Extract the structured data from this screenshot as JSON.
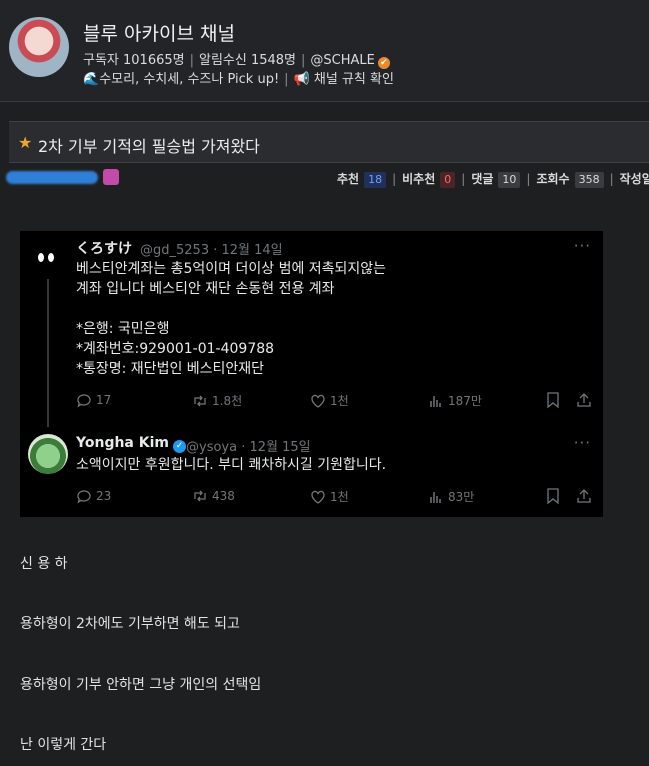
{
  "channel": {
    "name": "블루 아카이브 채널",
    "subscribers": "구독자 101665명",
    "notifications": "알림수신 1548명",
    "handle": "@SCHALE",
    "verified_mark": "✔",
    "link1_icon": "🌊",
    "link1": "수모리, 수치세, 수즈나 Pick up!",
    "link2_icon": "📢",
    "link2": "채널 규칙 확인"
  },
  "post": {
    "star": "★",
    "title": "2차 기부 기적의 필승법 가져왔다",
    "stats": {
      "recommend_label": "추천",
      "recommend": "18",
      "unrecommend_label": "비추천",
      "unrecommend": "0",
      "comments_label": "댓글",
      "comments": "10",
      "views_label": "조회수",
      "views": "358",
      "date_label": "작성일"
    }
  },
  "tweets": [
    {
      "name": "くろすけ",
      "handle": "@gd_5253 · 12월 14일",
      "more": "···",
      "lines": [
        "베스티안계좌는 총5억이며 더이상 범에 저촉되지않는",
        "계좌 입니다 베스티안 재단 손동현 전용 계좌",
        "",
        "*은행: 국민은행",
        "*계좌번호:929001-01-409788",
        "*통장명: 재단법인 베스티안재단"
      ],
      "replies": "17",
      "retweets": "1.8천",
      "likes": "1천",
      "views": "187만"
    },
    {
      "name": "Yongha Kim",
      "verified_mark": "✓",
      "handle": "@ysoya · 12월 15일",
      "more": "···",
      "lines": [
        "소액이지만 후원합니다. 부디 쾌차하시길 기원합니다."
      ],
      "replies": "23",
      "retweets": "438",
      "likes": "1천",
      "views": "83만"
    }
  ],
  "body_lines": [
    "신 용 하",
    "용하형이 2차에도 기부하면 해도 되고",
    "용하형이 기부 안하면 그냥 개인의 선택임",
    "난 이렇게 간다"
  ],
  "colors": {
    "background": "#1e1f21",
    "star": "#f0a52a",
    "verified_orange": "#e8892a",
    "twitter_blue": "#1d9bf0",
    "recommend_count": "#6aa0ff",
    "unrecommend_count": "#ff6a6a"
  }
}
